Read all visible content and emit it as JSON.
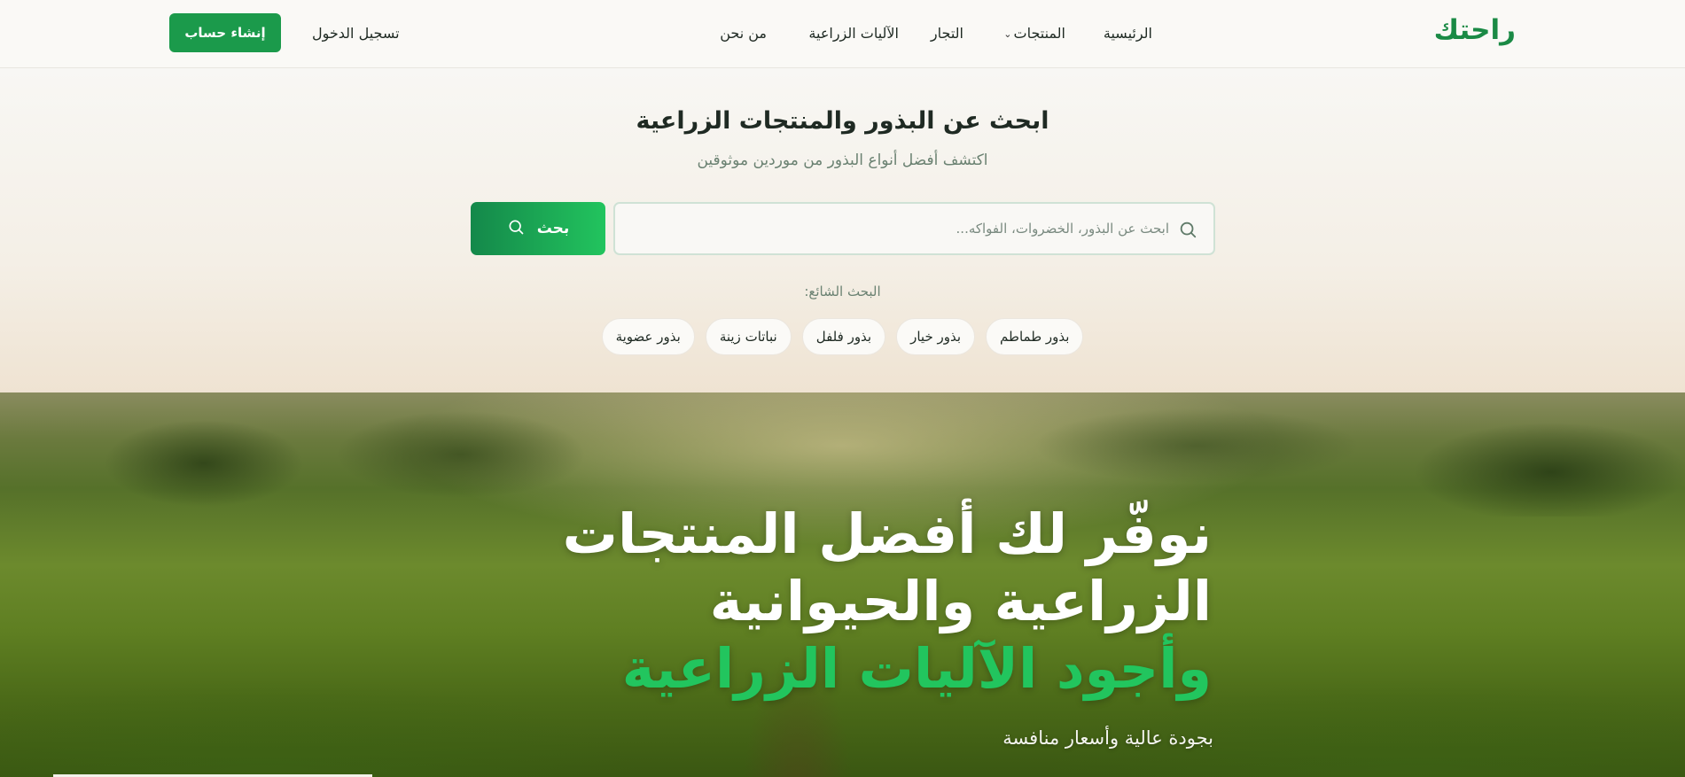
{
  "header": {
    "logo": "راحتك",
    "nav": {
      "home": "الرئيسية",
      "products": "المنتجات",
      "traders": "التجار",
      "machinery": "الآليات الزراعية",
      "about": "من نحن"
    },
    "login": "تسجيل الدخول",
    "signup": "إنشاء حساب"
  },
  "search": {
    "title": "ابحث عن البذور والمنتجات الزراعية",
    "subtitle": "اكتشف أفضل أنواع البذور من موردين موثوقين",
    "placeholder": "ابحث عن البذور، الخضروات، الفواكه...",
    "value": "",
    "button": "بحث",
    "popular_label": "البحث الشائع:",
    "popular": [
      "بذور طماطم",
      "بذور خيار",
      "بذور فلفل",
      "نباتات زينة",
      "بذور عضوية"
    ]
  },
  "hero": {
    "line1": "نوفّر لك أفضل المنتجات",
    "line2": "الزراعية والحيوانية",
    "line3": "وأجود الآليات الزراعية",
    "subtitle": "بجودة عالية وأسعار منافسة"
  },
  "colors": {
    "brand": "#1a8a45",
    "accent": "#22c55e",
    "button_start": "#14884a",
    "button_end": "#22c45e"
  }
}
